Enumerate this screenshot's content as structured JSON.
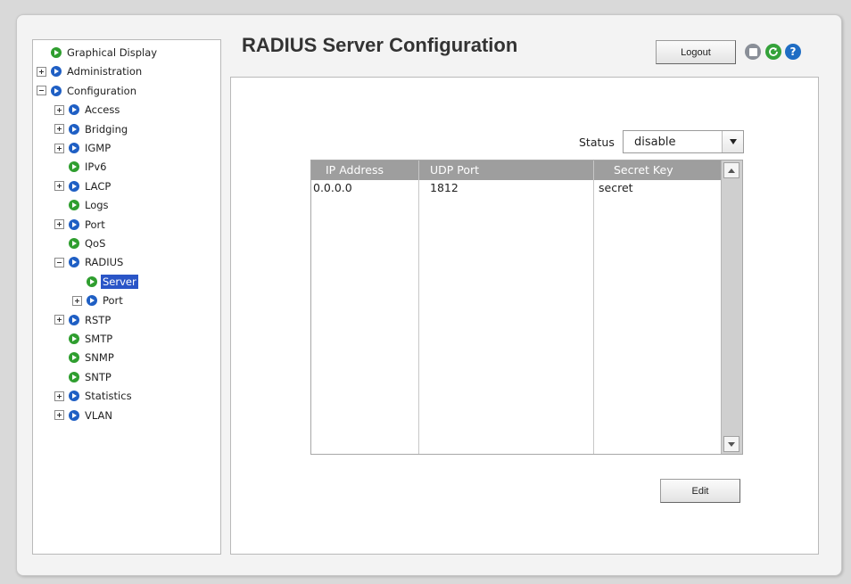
{
  "sidebar": {
    "items": [
      {
        "label": "Graphical Display",
        "expander": "none",
        "color": "green",
        "level": 0
      },
      {
        "label": "Administration",
        "expander": "plus",
        "color": "blue",
        "level": 0
      },
      {
        "label": "Configuration",
        "expander": "minus",
        "color": "blue",
        "level": 0
      },
      {
        "label": "Access",
        "expander": "plus",
        "color": "blue",
        "level": 1
      },
      {
        "label": "Bridging",
        "expander": "plus",
        "color": "blue",
        "level": 1
      },
      {
        "label": "IGMP",
        "expander": "plus",
        "color": "blue",
        "level": 1
      },
      {
        "label": "IPv6",
        "expander": "none",
        "color": "green",
        "level": 1
      },
      {
        "label": "LACP",
        "expander": "plus",
        "color": "blue",
        "level": 1
      },
      {
        "label": "Logs",
        "expander": "none",
        "color": "green",
        "level": 1
      },
      {
        "label": "Port",
        "expander": "plus",
        "color": "blue",
        "level": 1
      },
      {
        "label": "QoS",
        "expander": "none",
        "color": "green",
        "level": 1
      },
      {
        "label": "RADIUS",
        "expander": "minus",
        "color": "blue",
        "level": 1
      },
      {
        "label": "Server",
        "expander": "none",
        "color": "green",
        "level": 2,
        "selected": true
      },
      {
        "label": "Port",
        "expander": "plus",
        "color": "blue",
        "level": 2
      },
      {
        "label": "RSTP",
        "expander": "plus",
        "color": "blue",
        "level": 1
      },
      {
        "label": "SMTP",
        "expander": "none",
        "color": "green",
        "level": 1
      },
      {
        "label": "SNMP",
        "expander": "none",
        "color": "green",
        "level": 1
      },
      {
        "label": "SNTP",
        "expander": "none",
        "color": "green",
        "level": 1
      },
      {
        "label": "Statistics",
        "expander": "plus",
        "color": "blue",
        "level": 1
      },
      {
        "label": "VLAN",
        "expander": "plus",
        "color": "blue",
        "level": 1
      }
    ]
  },
  "header": {
    "title": "RADIUS Server Configuration",
    "logout_label": "Logout",
    "icons": [
      "save-icon",
      "refresh-icon",
      "help-icon"
    ],
    "help_glyph": "?"
  },
  "main": {
    "status_label": "Status",
    "status_value": "disable",
    "table": {
      "columns": [
        "IP Address",
        "UDP Port",
        "Secret Key"
      ],
      "rows": [
        [
          "0.0.0.0",
          "1812",
          "secret"
        ]
      ]
    },
    "edit_label": "Edit"
  },
  "colors": {
    "selected": "#2a55c7",
    "header_grey": "#9e9e9e",
    "arrow_green": "#2f9e2f",
    "arrow_blue": "#1f5fc4"
  }
}
